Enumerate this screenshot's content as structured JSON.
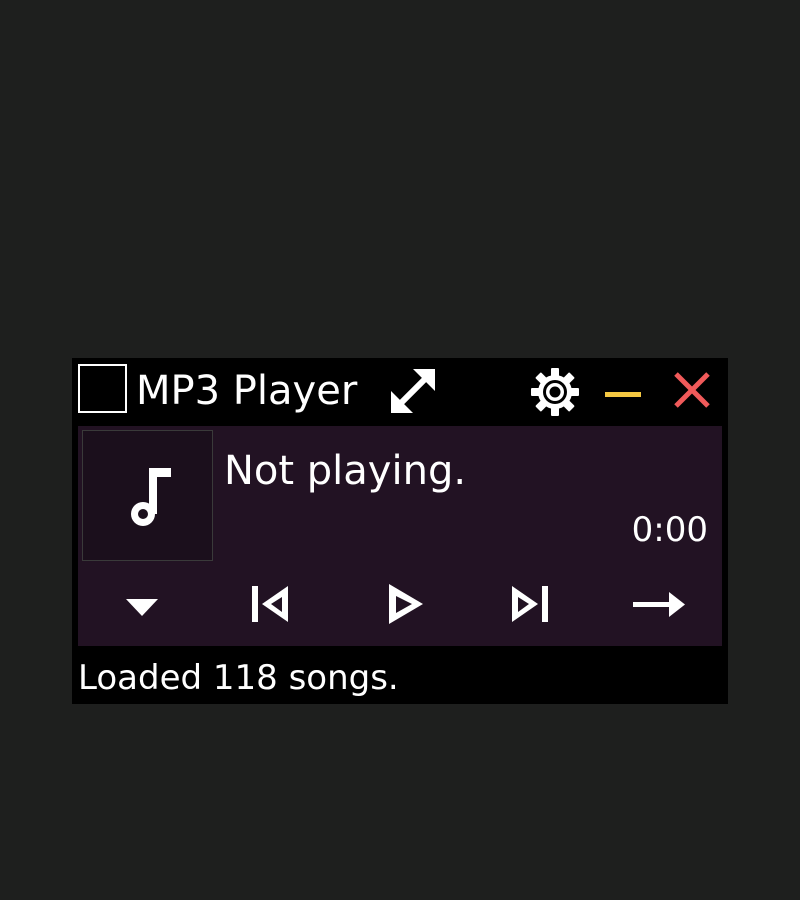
{
  "window": {
    "title": "MP3 Player"
  },
  "titlebar": {
    "icons": [
      "checkbox",
      "expand-icon",
      "gear-icon",
      "minimize-icon",
      "close-icon"
    ]
  },
  "colors": {
    "background": "#1e1f1e",
    "window": "#000000",
    "panel": "#221223",
    "minimize": "#f5c842",
    "close": "#f05a5a",
    "text": "#ffffff"
  },
  "player": {
    "status": "Not playing.",
    "time": "0:00",
    "album_art_icon": "music-note-icon",
    "controls": [
      "dropdown-arrow-icon",
      "previous-track-icon",
      "play-icon",
      "next-track-icon",
      "arrow-right-icon"
    ]
  },
  "footer": {
    "message": "Loaded 118 songs."
  }
}
